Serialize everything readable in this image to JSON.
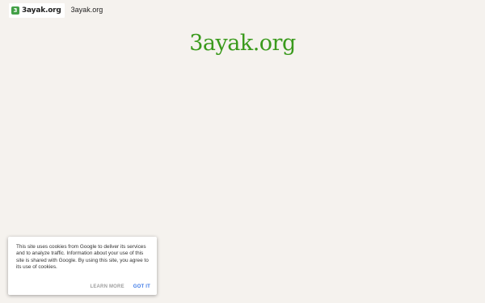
{
  "header": {
    "logo_mark": "3",
    "logo_text": "3ayak.org",
    "site_link": "3ayak.org"
  },
  "main": {
    "title": "3ayak.org"
  },
  "cookie_notice": {
    "message": "This site uses cookies from Google to deliver its services and to analyze traffic. Information about your use of this site is shared with Google. By using this site, you agree to its use of cookies.",
    "learn_more_label": "LEARN MORE",
    "got_it_label": "GOT IT"
  },
  "colors": {
    "background": "#f5f2ee",
    "title_green": "#3a9a1c",
    "logo_green": "#43a047",
    "got_it_blue": "#3b78e7",
    "learn_more_gray": "#9e9e9e"
  },
  "icons": {
    "logo": "blogger-site-logo-icon"
  }
}
